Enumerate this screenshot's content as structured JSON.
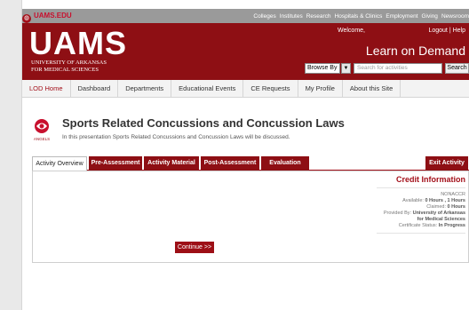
{
  "topbar": {
    "site": "UAMS.EDU",
    "links": [
      "Colleges",
      "Institutes",
      "Research",
      "Hospitals & Clinics",
      "Employment",
      "Giving",
      "Newsroom"
    ]
  },
  "header": {
    "logo": "UAMS",
    "university_line1": "UNIVERSITY OF ARKANSAS",
    "university_line2": "FOR MEDICAL SCIENCES",
    "welcome": "Welcome,",
    "logout": "Logout",
    "separator": "|",
    "help": "Help",
    "tagline": "Learn on Demand",
    "browse_label": "Browse By",
    "search_placeholder": "Search for activities",
    "search_button": "Search"
  },
  "nav": [
    "LOD Home",
    "Dashboard",
    "Departments",
    "Educational Events",
    "CE Requests",
    "My Profile",
    "About this Site"
  ],
  "activity": {
    "icon_caption": "ANGELS",
    "title": "Sports Related Concussions and Concussion Laws",
    "subtitle": "In this presentation Sports Related Concussions and Concussion Laws will be discussed."
  },
  "tabs": {
    "overview": "Activity Overview",
    "pre": "Pre-Assessment",
    "material": "Activity Material",
    "post": "Post-Assessment",
    "evaluation": "Evaluation",
    "exit": "Exit Activity"
  },
  "credit": {
    "heading": "Credit Information",
    "code": "NONACCR",
    "available_label": "Available:",
    "available_value": "0 Hours , 1 Hours",
    "claimed_label": "Claimed:",
    "claimed_value": "0 Hours",
    "provided_label": "Provided By:",
    "provided_value": "University of Arkansas for Medical Sciences",
    "status_label": "Certificate Status:",
    "status_value": "In Progress"
  },
  "continue_button": "Continue >>",
  "colors": {
    "brand_red": "#8e0f14",
    "accent_red": "#a3101a",
    "top_gray": "#9a9a9a"
  }
}
